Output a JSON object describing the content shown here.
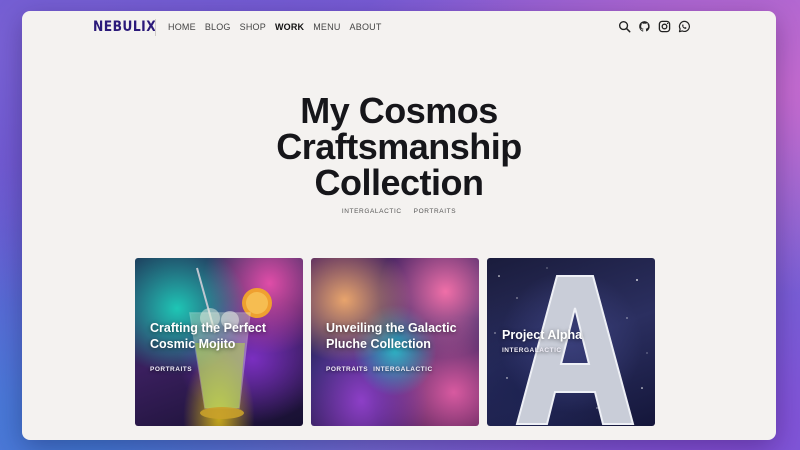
{
  "brand": {
    "logo": "NEBULIX"
  },
  "nav": {
    "items": [
      {
        "label": "HOME",
        "active": false
      },
      {
        "label": "BLOG",
        "active": false
      },
      {
        "label": "SHOP",
        "active": false
      },
      {
        "label": "WORK",
        "active": true
      },
      {
        "label": "MENU",
        "active": false
      },
      {
        "label": "ABOUT",
        "active": false
      }
    ],
    "icons": [
      "search-icon",
      "github-icon",
      "instagram-icon",
      "whatsapp-icon"
    ]
  },
  "hero": {
    "title_lines": [
      "My Cosmos",
      "Craftsmanship",
      "Collection"
    ],
    "tags": [
      "INTERGALACTIC",
      "PORTRAITS"
    ]
  },
  "cards": [
    {
      "title_lines": [
        "Crafting the Perfect",
        "Cosmic Mojito"
      ],
      "tags": [
        "PORTRAITS"
      ]
    },
    {
      "title_lines": [
        "Unveiling the Galactic",
        "Pluche Collection"
      ],
      "tags": [
        "PORTRAITS",
        "INTERGALACTIC"
      ]
    },
    {
      "title_lines": [
        "Project Alpha"
      ],
      "tags": [
        "INTERGALACTIC"
      ]
    }
  ],
  "colors": {
    "brand": "#2b1a7a",
    "page_bg": "#f4f2f0",
    "title": "#16161a"
  }
}
